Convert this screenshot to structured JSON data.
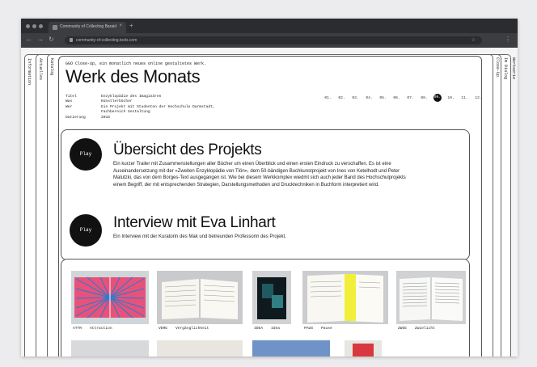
{
  "browser": {
    "tab_title": "Community of Collecting Baraid",
    "url": "community-of-collecting.tools.com"
  },
  "side_tabs": {
    "left": [
      "Information",
      "Aktuelles",
      "Katalog"
    ],
    "right": [
      "Close-Up",
      "Im Dialog",
      "Werkserie"
    ]
  },
  "header": {
    "tagline": "GGO Close-Up, ein monatlich neues online gestaltetes Werk.",
    "title": "Werk des Monats"
  },
  "meta": [
    {
      "key": "Titel",
      "value": "Enzyklopädie des Imaginären"
    },
    {
      "key": "Was",
      "value": "Künstlerbücher"
    },
    {
      "key": "Wer",
      "value": "Ein Projekt mit Studenten der Hochschule Darmstadt,"
    },
    {
      "key": "",
      "value": "Fachbereich Gestaltung"
    },
    {
      "key": "Datierung",
      "value": "2015"
    }
  ],
  "months": [
    "01.",
    "02.",
    "03.",
    "04.",
    "05.",
    "06.",
    "07.",
    "08.",
    "09.",
    "10.",
    "11.",
    "12."
  ],
  "active_month": "09.",
  "sections": [
    {
      "play_label": "Play",
      "heading": "Übersicht des Projekts",
      "text": "Ein kurzer Trailer mit Zusammenstellungen aller Bücher um einen Überblick und einen ersten Eindruck zu verschaffen. Es ist eine Auseinandersetzung mit der »Zweiten Enzyklopädie von Tlön«, dem 50-bändigen Buchkunstprojekt von Ines von Ketelhodt und Peter Malutzki, das von dem Borges-Text ausgegangen ist. Wie bei diesem Werkkomplex wiedmt sich auch jeder Band des Hochschulprojekts einem Begriff, der mit entsprechenden Strategien, Darstellungsmethoden und Drucktechniken in Buchform interpretiert wird."
    },
    {
      "play_label": "Play",
      "heading": "Interview mit Eva Linhart",
      "text": "Ein Interview mit der Kuratorin des Mak und betreunden Professorin des Projekt."
    }
  ],
  "gallery": [
    {
      "code": "ATTR",
      "label": "Attraction"
    },
    {
      "code": "VERG",
      "label": "Vergänglichkeit"
    },
    {
      "code": "IDEA",
      "label": "Idea"
    },
    {
      "code": "PAUS",
      "label": "Pause"
    },
    {
      "code": "ZWIE",
      "label": "Zwielicht"
    }
  ],
  "colors": {
    "chrome": "#2b2c2f",
    "accent_black": "#111111",
    "paper": "#ffffff"
  }
}
